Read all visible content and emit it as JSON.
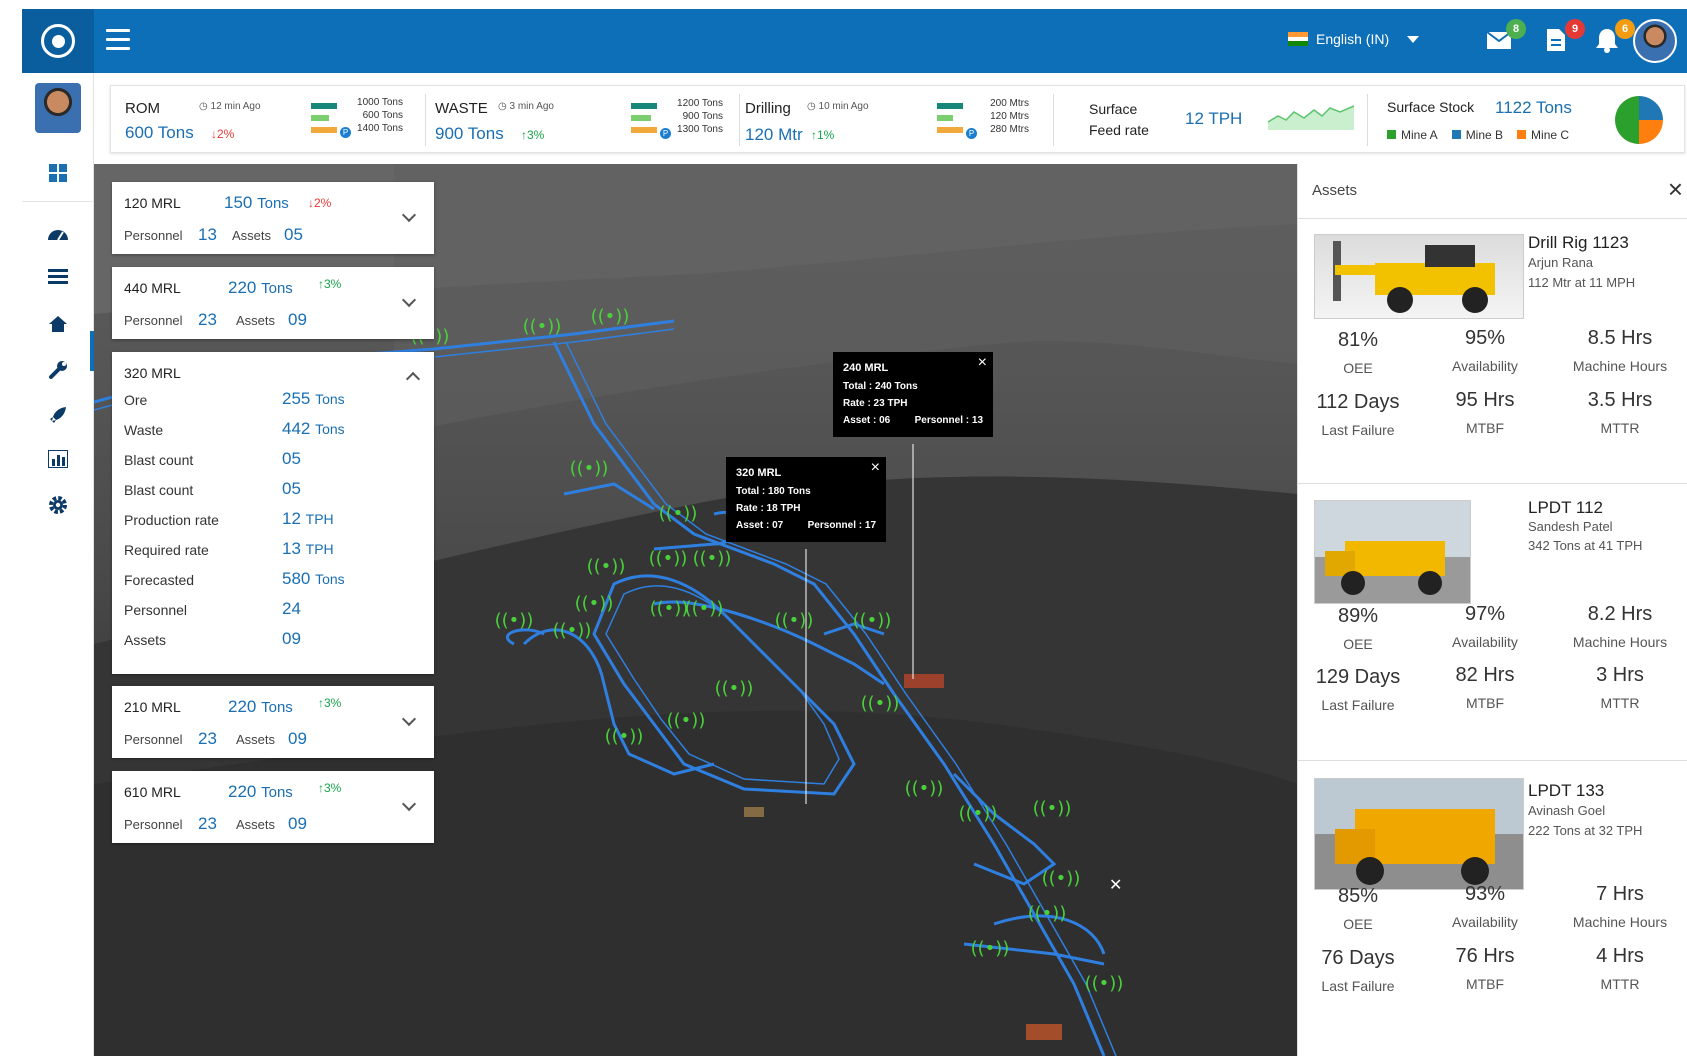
{
  "topbar": {
    "language": "English (IN)",
    "badges": {
      "mail": "8",
      "doc": "9",
      "bell": "6"
    },
    "colors": {
      "primary": "#0d6fb8",
      "mail_badge": "#4caf50",
      "doc_badge": "#e53935",
      "bell_badge": "#f39c12"
    }
  },
  "sidebar": {
    "items": [
      "dashboard-grid",
      "gauge",
      "layers",
      "home",
      "wrench",
      "rocket",
      "bar-chart",
      "settings"
    ]
  },
  "kpis": {
    "rom": {
      "name": "ROM",
      "ago": "12 min Ago",
      "value": "600 Tons",
      "delta": "2%",
      "legend": [
        "1000 Tons",
        "600 Tons",
        "1400 Tons"
      ],
      "legend_tag": "P"
    },
    "waste": {
      "name": "WASTE",
      "ago": "3 min Ago",
      "value": "900 Tons",
      "delta": "3%",
      "legend": [
        "1200 Tons",
        "900 Tons",
        "1300 Tons"
      ],
      "legend_tag": "P"
    },
    "drilling": {
      "name": "Drilling",
      "ago": "10 min Ago",
      "value": "120 Mtr",
      "delta": "1%",
      "legend": [
        "200 Mtrs",
        "120 Mtrs",
        "280 Mtrs"
      ],
      "legend_tag": "P"
    },
    "feed": {
      "name1": "Surface",
      "name2": "Feed rate",
      "value": "12 TPH"
    },
    "stock": {
      "name": "Surface Stock",
      "value": "1122 Tons",
      "legend": [
        "Mine A",
        "Mine B",
        "Mine C"
      ],
      "colors": [
        "#2ca02c",
        "#1f77b4",
        "#ff7f0e"
      ]
    }
  },
  "levels": [
    {
      "name": "120 MRL",
      "tons": "150",
      "unit": "Tons",
      "delta": "2%",
      "dir": "down",
      "personnel_label": "Personnel",
      "personnel": "13",
      "assets_label": "Assets",
      "assets": "05"
    },
    {
      "name": "440 MRL",
      "tons": "220",
      "unit": "Tons",
      "delta": "3%",
      "dir": "up",
      "personnel_label": "Personnel",
      "personnel": "23",
      "assets_label": "Assets",
      "assets": "09"
    },
    {
      "name": "210 MRL",
      "tons": "220",
      "unit": "Tons",
      "delta": "3%",
      "dir": "up",
      "personnel_label": "Personnel",
      "personnel": "23",
      "assets_label": "Assets",
      "assets": "09"
    },
    {
      "name": "610 MRL",
      "tons": "220",
      "unit": "Tons",
      "delta": "3%",
      "dir": "up",
      "personnel_label": "Personnel",
      "personnel": "23",
      "assets_label": "Assets",
      "assets": "09"
    }
  ],
  "expanded": {
    "name": "320 MRL",
    "rows": [
      {
        "label": "Ore",
        "value": "255",
        "unit": "Tons"
      },
      {
        "label": "Waste",
        "value": "442",
        "unit": "Tons"
      },
      {
        "label": "Blast count",
        "value": "05",
        "unit": ""
      },
      {
        "label": "Blast count",
        "value": "05",
        "unit": ""
      },
      {
        "label": "Production rate",
        "value": "12",
        "unit": "TPH"
      },
      {
        "label": "Required rate",
        "value": "13",
        "unit": "TPH"
      },
      {
        "label": "Forecasted",
        "value": "580",
        "unit": "Tons"
      },
      {
        "label": "Personnel",
        "value": "24",
        "unit": ""
      },
      {
        "label": "Assets",
        "value": "09",
        "unit": ""
      }
    ]
  },
  "tooltips": [
    {
      "title": "240 MRL",
      "total": "Total : 240 Tons",
      "rate": "Rate : 23 TPH",
      "asset": "Asset : 06",
      "personnel": "Personnel : 13"
    },
    {
      "title": "320 MRL",
      "total": "Total : 180 Tons",
      "rate": "Rate : 18 TPH",
      "asset": "Asset : 07",
      "personnel": "Personnel : 17"
    }
  ],
  "assets_panel": {
    "title": "Assets",
    "items": [
      {
        "name": "Drill Rig 1123",
        "operator": "Arjun Rana",
        "info": "112 Mtr at 11 MPH",
        "stats": [
          [
            "81%",
            "OEE"
          ],
          [
            "95%",
            "Availability"
          ],
          [
            "8.5 Hrs",
            "Machine Hours"
          ],
          [
            "112 Days",
            "Last Failure"
          ],
          [
            "95 Hrs",
            "MTBF"
          ],
          [
            "3.5 Hrs",
            "MTTR"
          ]
        ]
      },
      {
        "name": "LPDT 112",
        "operator": "Sandesh Patel",
        "info": "342 Tons at 41 TPH",
        "stats": [
          [
            "89%",
            "OEE"
          ],
          [
            "97%",
            "Availability"
          ],
          [
            "8.2 Hrs",
            "Machine Hours"
          ],
          [
            "129 Days",
            "Last Failure"
          ],
          [
            "82 Hrs",
            "MTBF"
          ],
          [
            "3 Hrs",
            "MTTR"
          ]
        ]
      },
      {
        "name": "LPDT 133",
        "operator": "Avinash Goel",
        "info": "222 Tons at 32 TPH",
        "stats": [
          [
            "85%",
            "OEE"
          ],
          [
            "93%",
            "Availability"
          ],
          [
            "7 Hrs",
            "Machine Hours"
          ],
          [
            "76 Days",
            "Last Failure"
          ],
          [
            "76 Hrs",
            "MTBF"
          ],
          [
            "4 Hrs",
            "MTTR"
          ]
        ]
      }
    ]
  }
}
